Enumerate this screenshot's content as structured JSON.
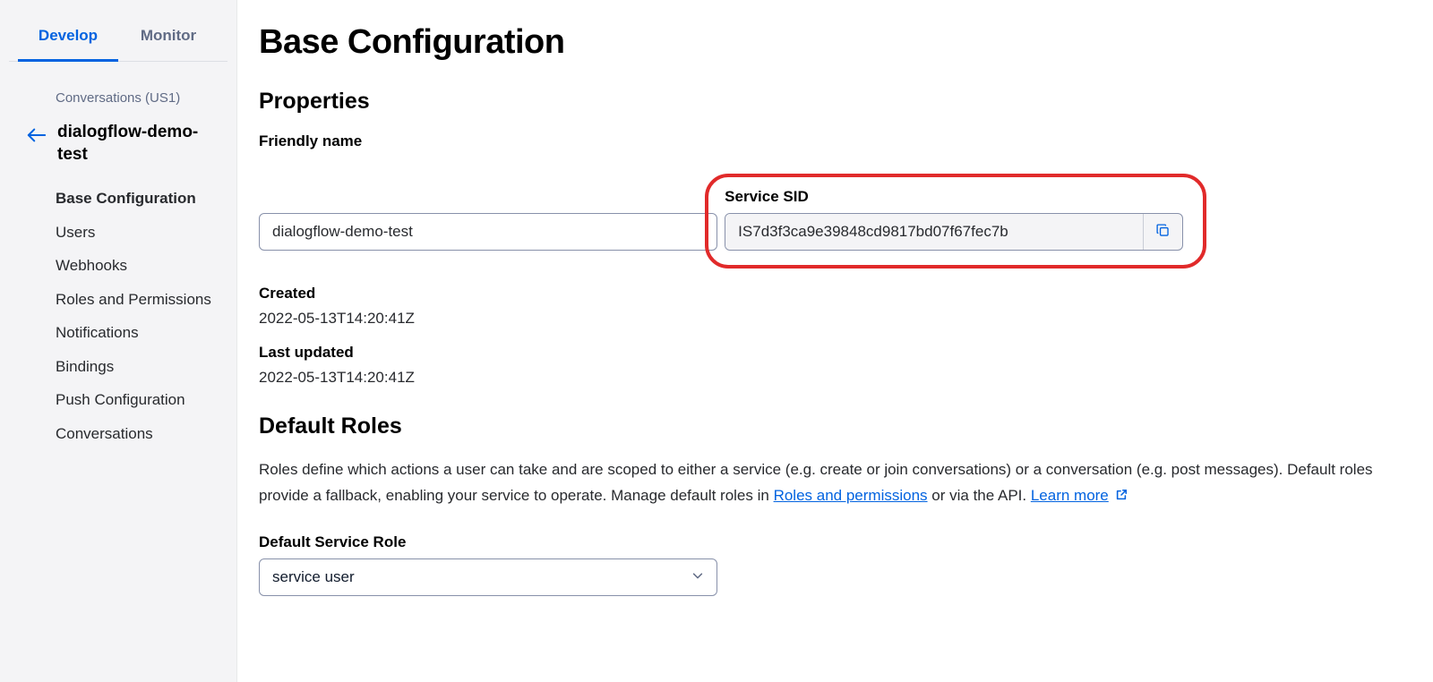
{
  "tabs": {
    "develop": "Develop",
    "monitor": "Monitor"
  },
  "breadcrumb": "Conversations (US1)",
  "service_name": "dialogflow-demo-test",
  "nav": {
    "base_configuration": "Base Configuration",
    "users": "Users",
    "webhooks": "Webhooks",
    "roles_permissions": "Roles and Permissions",
    "notifications": "Notifications",
    "bindings": "Bindings",
    "push_configuration": "Push Configuration",
    "conversations": "Conversations"
  },
  "page_title": "Base Configuration",
  "sections": {
    "properties": "Properties",
    "default_roles": "Default Roles"
  },
  "labels": {
    "friendly_name": "Friendly name",
    "service_sid": "Service SID",
    "created": "Created",
    "last_updated": "Last updated",
    "default_service_role": "Default Service Role"
  },
  "values": {
    "friendly_name": "dialogflow-demo-test",
    "service_sid": "IS7d3f3ca9e39848cd9817bd07f67fec7b",
    "created": "2022-05-13T14:20:41Z",
    "last_updated": "2022-05-13T14:20:41Z",
    "default_service_role": "service user"
  },
  "roles_desc": {
    "t1": "Roles define which actions a user can take and are scoped to either a service (e.g. create or join conversations) or a conversation (e.g. post messages). Default roles provide a fallback, enabling your service to operate. Manage default roles in  ",
    "link1": "Roles and permissions",
    "t2": " or via the API. ",
    "link2": "Learn more"
  }
}
